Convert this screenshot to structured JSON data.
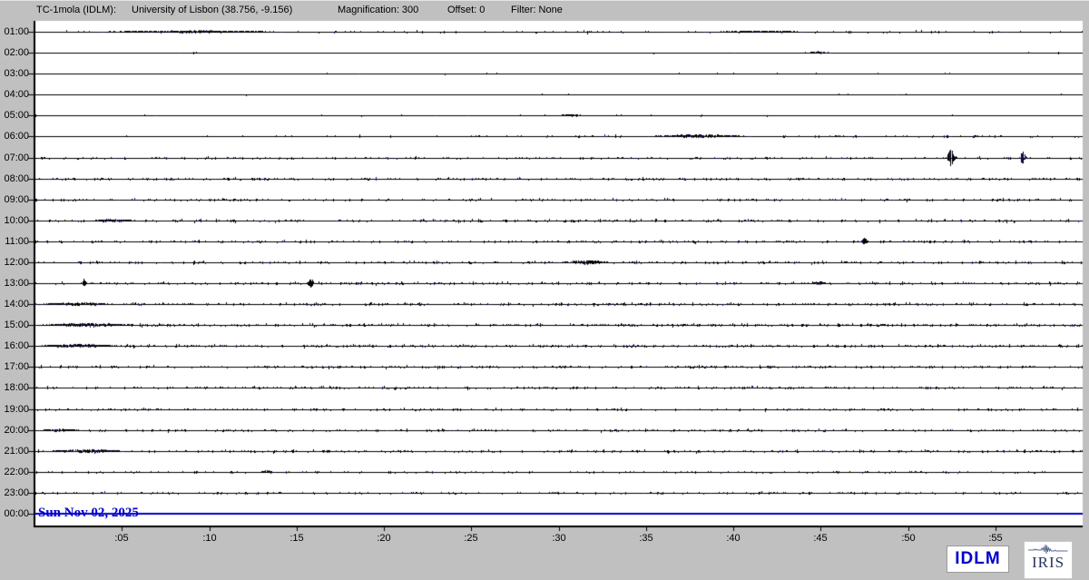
{
  "header": {
    "station": "TC-1mola (IDLM):",
    "location": "University of Lisbon (38.756, -9.156)",
    "magnification": "Magnification: 300",
    "offset": "Offset: 0",
    "filter": "Filter: None"
  },
  "date_label": "Sun Nov 02, 2025",
  "footer": {
    "idlm_label": "IDLM",
    "iris_label": "IRIS"
  },
  "colors": {
    "background": "#c0c0c0",
    "plot_bg": "#ffffff",
    "trace": "#000000",
    "trace_alt": "#191970",
    "accent_blue": "#0000cc",
    "iris_navy": "#283460"
  },
  "chart_data": {
    "type": "line",
    "subtype": "helicorder-24h",
    "title": "24-hour seismic helicorder record, station TC-1mola (IDLM), Sun Nov 02 2025",
    "date": "Sun Nov 02, 2025",
    "magnification": 300,
    "offset": 0,
    "filter": "None",
    "x_axis": {
      "unit": "minutes past the hour",
      "range": [
        0,
        60
      ],
      "ticks": [
        ":05",
        ":10",
        ":15",
        ":20",
        ":25",
        ":30",
        ":35",
        ":40",
        ":45",
        ":50",
        ":55"
      ],
      "grid": false
    },
    "y_axis": {
      "unit": "hour of day (one trace row per hour)",
      "rows_top_to_bottom": 24
    },
    "legend": "none",
    "notable_events": [
      {
        "row": "07:00",
        "minute": 52.4,
        "rel_amplitude": 10,
        "note": "largest spike burst"
      },
      {
        "row": "07:00",
        "minute": 56.5,
        "rel_amplitude": 8,
        "note": "second spike burst"
      },
      {
        "row": "11:00",
        "minute": 47.5,
        "rel_amplitude": 5.5,
        "note": "single spike"
      },
      {
        "row": "13:00",
        "minute": 2.8,
        "rel_amplitude": 5,
        "note": "single spike"
      },
      {
        "row": "13:00",
        "minute": 15.8,
        "rel_amplitude": 6.5,
        "note": "single spike"
      }
    ],
    "rows": [
      {
        "hour": "01:00",
        "density": 0.12,
        "amp": 1.6,
        "ramp": 0,
        "is_current_blue": false,
        "events": [
          {
            "minute": 9,
            "width": 4.5,
            "amp": 1.7
          },
          {
            "minute": 41.5,
            "width": 2.2,
            "amp": 1.5
          }
        ]
      },
      {
        "hour": "02:00",
        "density": 0.02,
        "amp": 1.2,
        "ramp": 0,
        "is_current_blue": false,
        "events": [
          {
            "minute": 44.8,
            "width": 0.7,
            "amp": 1.6
          }
        ]
      },
      {
        "hour": "03:00",
        "density": 0.015,
        "amp": 1.1,
        "ramp": 0,
        "is_current_blue": false,
        "events": []
      },
      {
        "hour": "04:00",
        "density": 0.02,
        "amp": 1.2,
        "ramp": 0,
        "is_current_blue": false,
        "events": []
      },
      {
        "hour": "05:00",
        "density": 0.03,
        "amp": 1.2,
        "ramp": 0,
        "is_current_blue": false,
        "events": [
          {
            "minute": 30.8,
            "width": 0.6,
            "amp": 1.6
          }
        ]
      },
      {
        "hour": "06:00",
        "density": 0.12,
        "amp": 1.5,
        "ramp": 0.9,
        "is_current_blue": false,
        "events": [
          {
            "minute": 38,
            "width": 2.2,
            "amp": 2.3
          }
        ]
      },
      {
        "hour": "07:00",
        "density": 0.25,
        "amp": 1.5,
        "ramp": 0,
        "is_current_blue": false,
        "events": [
          {
            "minute": 52.45,
            "width": 0.22,
            "amp": 10
          },
          {
            "minute": 56.55,
            "width": 0.16,
            "amp": 8
          }
        ]
      },
      {
        "hour": "08:00",
        "density": 0.3,
        "amp": 1.6,
        "ramp": 0,
        "is_current_blue": false,
        "events": []
      },
      {
        "hour": "09:00",
        "density": 0.3,
        "amp": 1.6,
        "ramp": 0,
        "is_current_blue": false,
        "events": []
      },
      {
        "hour": "10:00",
        "density": 0.3,
        "amp": 1.7,
        "ramp": 0,
        "is_current_blue": false,
        "events": [
          {
            "minute": 4.5,
            "width": 1.2,
            "amp": 1.9
          }
        ]
      },
      {
        "hour": "11:00",
        "density": 0.28,
        "amp": 1.6,
        "ramp": 0,
        "is_current_blue": false,
        "events": [
          {
            "minute": 47.5,
            "width": 0.14,
            "amp": 5.5
          }
        ]
      },
      {
        "hour": "12:00",
        "density": 0.3,
        "amp": 1.7,
        "ramp": 0,
        "is_current_blue": false,
        "events": [
          {
            "minute": 31.5,
            "width": 1.1,
            "amp": 2.8
          }
        ]
      },
      {
        "hour": "13:00",
        "density": 0.3,
        "amp": 1.7,
        "ramp": 0,
        "is_current_blue": false,
        "events": [
          {
            "minute": 2.8,
            "width": 0.14,
            "amp": 5
          },
          {
            "minute": 15.8,
            "width": 0.14,
            "amp": 6.5
          },
          {
            "minute": 44.9,
            "width": 0.35,
            "amp": 2.5
          }
        ]
      },
      {
        "hour": "14:00",
        "density": 0.32,
        "amp": 1.7,
        "ramp": 0,
        "is_current_blue": false,
        "events": [
          {
            "minute": 2.5,
            "width": 1.8,
            "amp": 2.1
          }
        ]
      },
      {
        "hour": "15:00",
        "density": 0.35,
        "amp": 1.8,
        "ramp": 0,
        "is_current_blue": false,
        "events": [
          {
            "minute": 3,
            "width": 2.2,
            "amp": 2.3
          }
        ]
      },
      {
        "hour": "16:00",
        "density": 0.35,
        "amp": 1.8,
        "ramp": 0,
        "is_current_blue": false,
        "events": [
          {
            "minute": 2.5,
            "width": 2,
            "amp": 2.1
          }
        ]
      },
      {
        "hour": "17:00",
        "density": 0.3,
        "amp": 1.6,
        "ramp": 0,
        "is_current_blue": false,
        "events": []
      },
      {
        "hour": "18:00",
        "density": 0.3,
        "amp": 1.6,
        "ramp": 0,
        "is_current_blue": false,
        "events": []
      },
      {
        "hour": "19:00",
        "density": 0.28,
        "amp": 1.5,
        "ramp": 0,
        "is_current_blue": false,
        "events": []
      },
      {
        "hour": "20:00",
        "density": 0.28,
        "amp": 1.5,
        "ramp": 0,
        "is_current_blue": false,
        "events": [
          {
            "minute": 1.5,
            "width": 1,
            "amp": 1.9
          }
        ]
      },
      {
        "hour": "21:00",
        "density": 0.3,
        "amp": 1.6,
        "ramp": 0,
        "is_current_blue": false,
        "events": [
          {
            "minute": 3,
            "width": 1.7,
            "amp": 2.5
          }
        ]
      },
      {
        "hour": "22:00",
        "density": 0.2,
        "amp": 1.4,
        "ramp": 0,
        "is_current_blue": false,
        "events": [
          {
            "minute": 13.3,
            "width": 0.35,
            "amp": 2
          }
        ]
      },
      {
        "hour": "23:00",
        "density": 0.22,
        "amp": 1.4,
        "ramp": 0,
        "is_current_blue": false,
        "events": []
      },
      {
        "hour": "00:00",
        "density": 0,
        "amp": 0,
        "ramp": 0,
        "is_current_blue": true,
        "events": []
      }
    ]
  }
}
